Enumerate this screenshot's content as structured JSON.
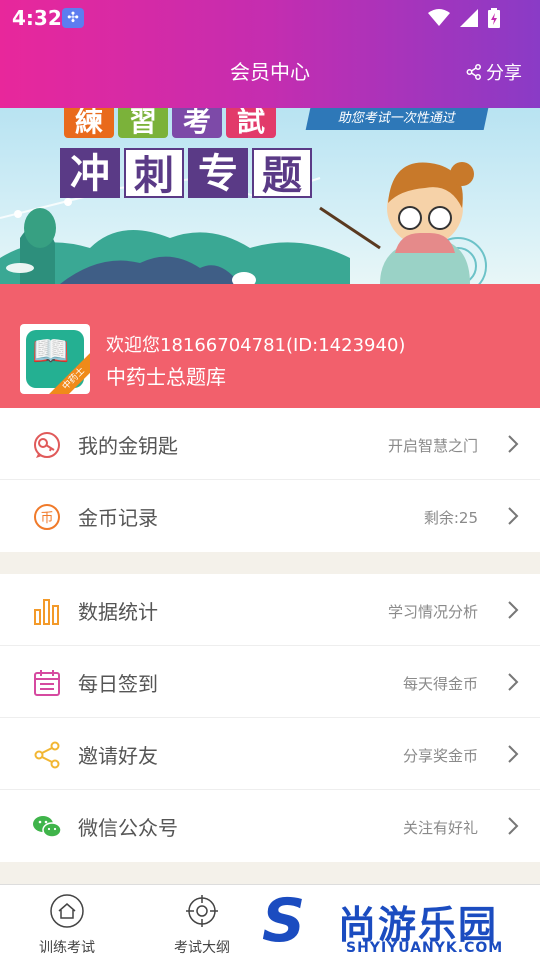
{
  "status": {
    "time": "4:32"
  },
  "header": {
    "title": "会员中心",
    "share_label": "分享"
  },
  "banner": {
    "tag": "助您考试一次性通过",
    "title_top": [
      "練",
      "習",
      "考",
      "試"
    ],
    "title_main": [
      "冲",
      "刺",
      "专",
      "题"
    ]
  },
  "profile": {
    "welcome": "欢迎您18166704781(ID:1423940)",
    "bank_name": "中药士总题库",
    "avatar_ribbon": "中药士"
  },
  "list1": [
    {
      "label": "我的金钥匙",
      "hint": "开启智慧之门",
      "icon": "key-icon"
    },
    {
      "label": "金币记录",
      "hint": "剩余:25",
      "icon": "coin-icon"
    }
  ],
  "list2": [
    {
      "label": "数据统计",
      "hint": "学习情况分析",
      "icon": "bar-chart-icon"
    },
    {
      "label": "每日签到",
      "hint": "每天得金币",
      "icon": "calendar-icon"
    },
    {
      "label": "邀请好友",
      "hint": "分享奖金币",
      "icon": "share-icon"
    },
    {
      "label": "微信公众号",
      "hint": "关注有好礼",
      "icon": "wechat-icon"
    }
  ],
  "bottom_nav": [
    {
      "label": "训练考试",
      "icon": "home-icon"
    },
    {
      "label": "考试大纲",
      "icon": "target-icon"
    }
  ],
  "watermark": {
    "cn": "尚游乐园",
    "en": "SHYIYUANYK.COM"
  },
  "colors": {
    "header_start": "#e8279b",
    "header_end": "#8a3bc6",
    "profile_bg": "#f2606c",
    "key": "#e05a5a",
    "coin": "#f07a2a",
    "bar": "#f39a2a",
    "calendar": "#d64aa0",
    "share": "#f2b632",
    "wechat": "#3fb44a"
  }
}
